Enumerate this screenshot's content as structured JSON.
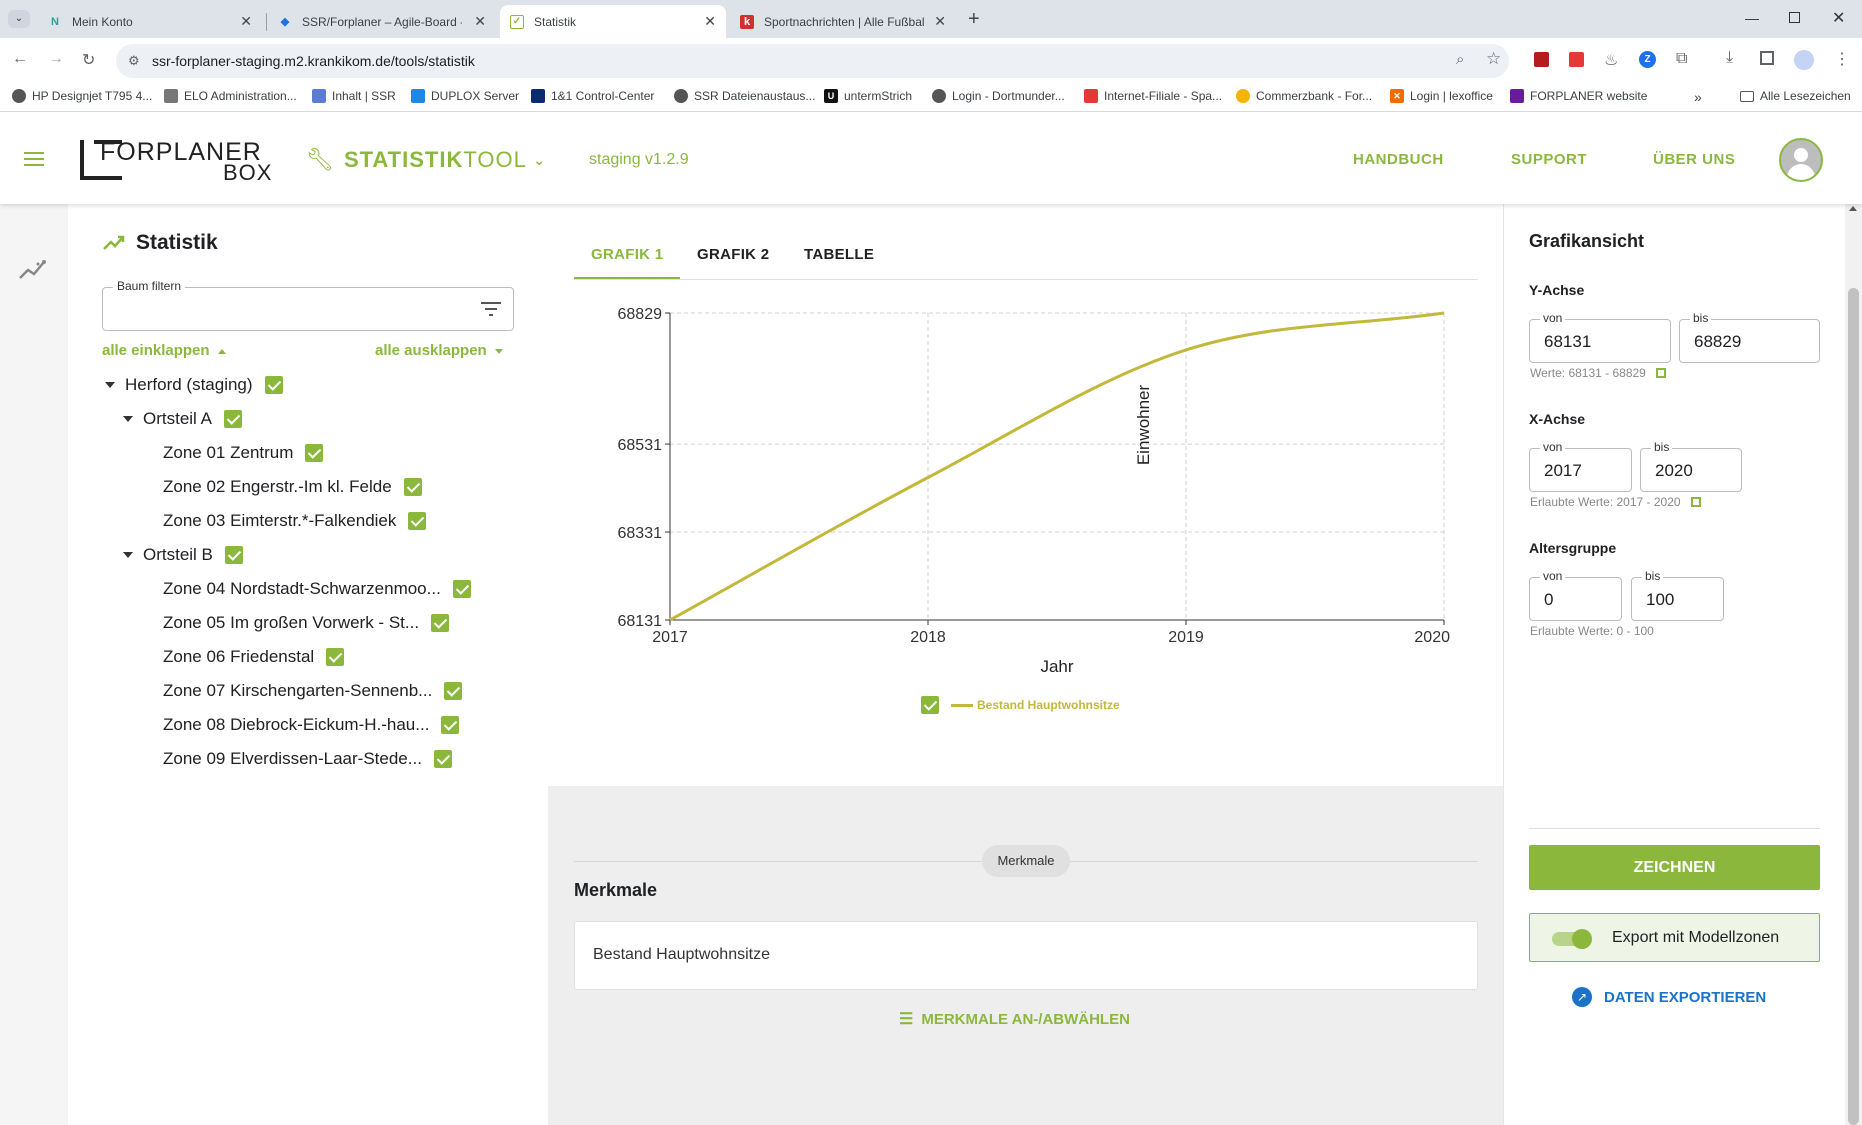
{
  "browser": {
    "tabs": [
      {
        "title": "Mein Konto",
        "icon": "notion-icon"
      },
      {
        "title": "SSR/Forplaner – Agile-Board - J",
        "icon": "jira-icon"
      },
      {
        "title": "Statistik",
        "icon": "check-icon"
      },
      {
        "title": "Sportnachrichten | Alle Fußball",
        "icon": "kicker-icon"
      }
    ],
    "url": "ssr-forplaner-staging.m2.krankikom.de/tools/statistik",
    "bookmarks": [
      "HP Designjet T795 4...",
      "ELO Administration...",
      "Inhalt | SSR",
      "DUPLOX Server",
      "1&1 Control-Center",
      "SSR Dateienaustaus...",
      "untermStrich",
      "Login - Dortmunder...",
      "Internet-Filiale - Spa...",
      "Commerzbank - For...",
      "Login | lexoffice",
      "FORPLANER website"
    ],
    "all_bookmarks": "Alle Lesezeichen"
  },
  "header": {
    "logo_top": "FORPLANER",
    "logo_bottom": "BOX",
    "tool_bold": "STATISTIK",
    "tool_light": "TOOL",
    "version": "staging v1.2.9",
    "nav": [
      "HANDBUCH",
      "SUPPORT",
      "ÜBER UNS"
    ]
  },
  "left": {
    "title": "Statistik",
    "filter_label": "Baum filtern",
    "collapse_all": "alle einklappen",
    "expand_all": "alle ausklappen",
    "root": "Herford (staging)",
    "groupA": "Ortsteil A",
    "zonesA": [
      "Zone 01 Zentrum",
      "Zone 02 Engerstr.-Im kl. Felde",
      "Zone 03 Eimterstr.*-Falkendiek"
    ],
    "groupB": "Ortsteil B",
    "zonesB": [
      "Zone 04 Nordstadt-Schwarzenmoo...",
      "Zone 05 Im großen Vorwerk - St...",
      "Zone 06 Friedenstal",
      "Zone 07 Kirschengarten-Sennenb...",
      "Zone 08 Diebrock-Eickum-H.-hau...",
      "Zone 09 Elverdissen-Laar-Stede..."
    ]
  },
  "center": {
    "tabs": [
      "GRAFIK 1",
      "GRAFIK 2",
      "TABELLE"
    ],
    "merkmale_chip": "Merkmale",
    "merkmale_title": "Merkmale",
    "merkmale_value": "Bestand Hauptwohnsitze",
    "merkmale_button": "MERKMALE AN-/ABWÄHLEN"
  },
  "chart_data": {
    "type": "line",
    "title": "",
    "xlabel": "Jahr",
    "ylabel": "Einwohner",
    "x": [
      2017,
      2018,
      2019,
      2020
    ],
    "series": [
      {
        "name": "Bestand Hauptwohnsitze",
        "values": [
          68131,
          68455,
          68745,
          68829
        ],
        "color": "#c2b83a"
      }
    ],
    "xlim": [
      2017,
      2020
    ],
    "ylim": [
      68131,
      68829
    ],
    "yticks": [
      68131,
      68331,
      68531,
      68829
    ],
    "grid": true,
    "legend": "bottom"
  },
  "right": {
    "title": "Grafikansicht",
    "y_axis": {
      "label": "Y-Achse",
      "from_label": "von",
      "from": "68131",
      "to_label": "bis",
      "to": "68829",
      "hint": "Werte: 68131 - 68829"
    },
    "x_axis": {
      "label": "X-Achse",
      "from_label": "von",
      "from": "2017",
      "to_label": "bis",
      "to": "2020",
      "hint": "Erlaubte Werte: 2017 - 2020"
    },
    "age": {
      "label": "Altersgruppe",
      "from_label": "von",
      "from": "0",
      "to_label": "bis",
      "to": "100",
      "hint": "Erlaubte Werte: 0 - 100"
    },
    "draw_button": "ZEICHNEN",
    "export_toggle": "Export mit Modellzonen",
    "export_button": "DATEN EXPORTIEREN"
  },
  "colors": {
    "accent": "#8bb83c",
    "series": "#c2b83a",
    "link_blue": "#1a73c8"
  }
}
